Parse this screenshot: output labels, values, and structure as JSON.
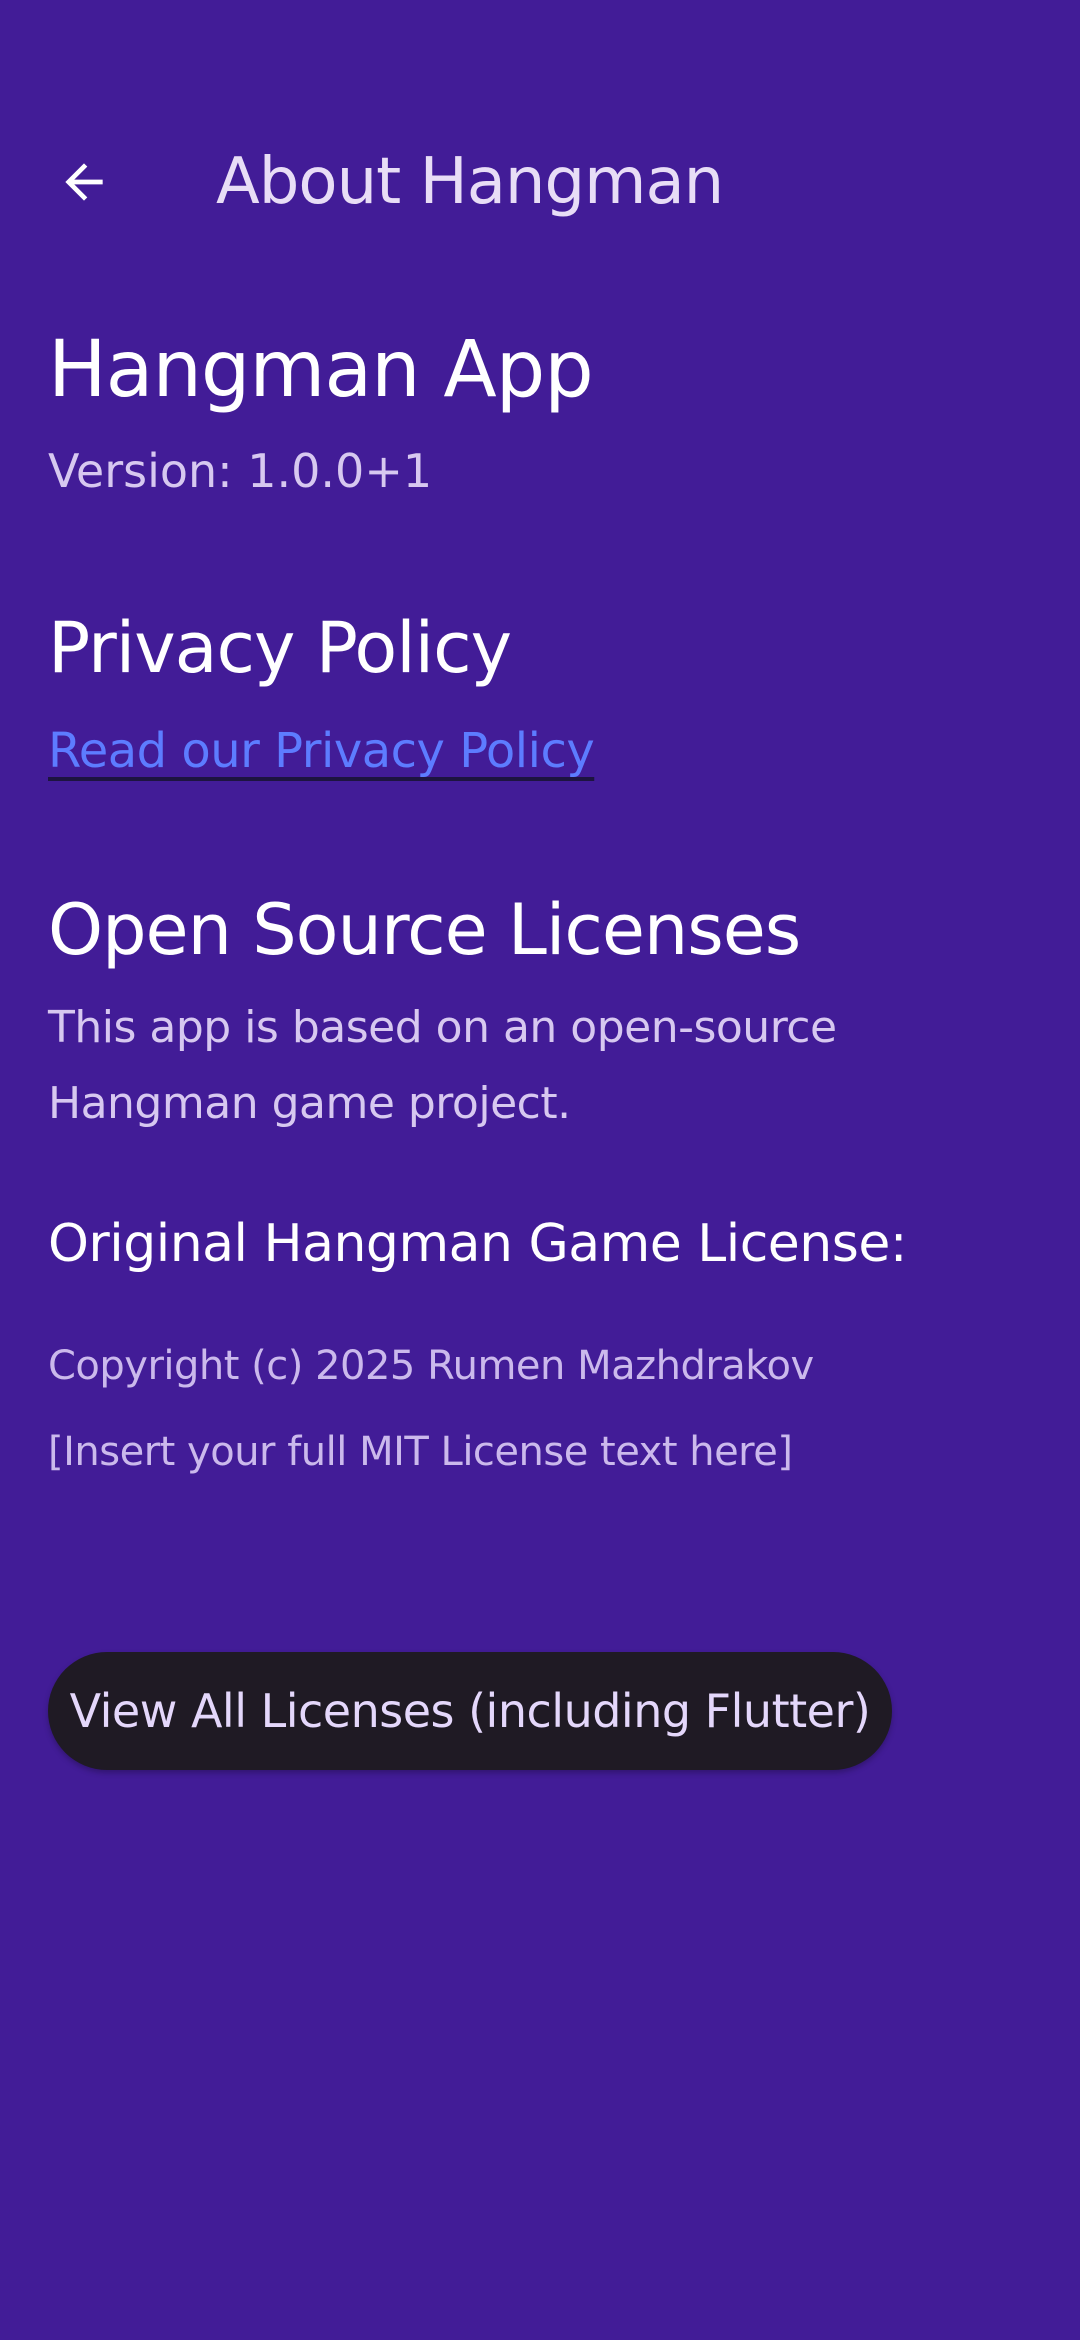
{
  "app_bar": {
    "back_icon": "arrow-left-icon",
    "title": "About Hangman"
  },
  "app_info": {
    "name": "Hangman App",
    "version": "Version: 1.0.0+1"
  },
  "privacy": {
    "title": "Privacy Policy",
    "link_text": "Read our Privacy Policy"
  },
  "licenses": {
    "title": "Open Source Licenses",
    "description": "This app is based on an open-source Hangman game project.",
    "original_title": "Original Hangman Game License:",
    "copyright": "Copyright (c) 2025 Rumen Mazhdrakov",
    "license_text": "[Insert your full MIT License text here]",
    "button_label": "View All Licenses (including Flutter)"
  },
  "colors": {
    "background": "#421c97",
    "link": "#5d7cff",
    "button_background": "#1f1a24",
    "button_text": "#e4d7fb"
  }
}
